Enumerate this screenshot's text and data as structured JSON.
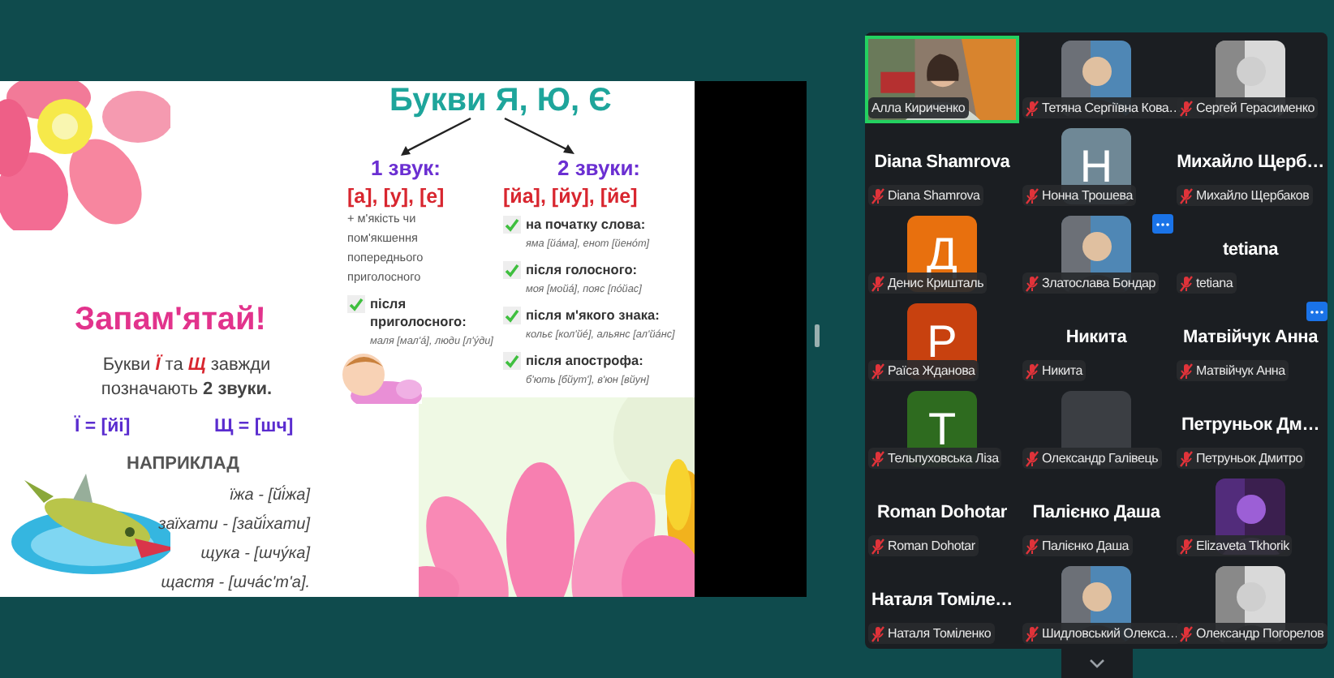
{
  "slide": {
    "title": "Букви Я, Ю, Є",
    "one_sound": {
      "heading": "1 звук:",
      "sounds": "[а], [у], [е]",
      "note": "+ м'якість чи пом'якшення попереднього приголосного",
      "rules": [
        {
          "label": "після приголосного:",
          "examples": "маля [мал'á], люди [л'у́ди]"
        }
      ]
    },
    "two_sounds": {
      "heading": "2 звуки:",
      "sounds": "[йа], [йу], [йе]",
      "rules": [
        {
          "label": "на початку слова:",
          "examples": "яма [йáма], енот [йенóт]"
        },
        {
          "label": "після голосного:",
          "examples": "моя [мойá], пояс [пóйас]"
        },
        {
          "label": "після м'якого знака:",
          "examples": "кольє [кол'йé], альянс [ал'йáнс]"
        },
        {
          "label": "після апострофа:",
          "examples": "б'ють [бйут'], в'юн [вйун]"
        }
      ]
    },
    "reminder": {
      "title": "Запам'ятай!",
      "text_parts": [
        {
          "text": "Букви ",
          "kind": "plain"
        },
        {
          "text": "Ї",
          "kind": "letter"
        },
        {
          "text": " та ",
          "kind": "plain"
        },
        {
          "text": "Щ",
          "kind": "letter"
        },
        {
          "text": " завжди позначають ",
          "kind": "plain"
        },
        {
          "text": "2 звуки.",
          "kind": "bold"
        }
      ],
      "formulas": [
        "Ї = [йі]",
        "Щ = [шч]"
      ],
      "examples_heading": "НАПРИКЛАД",
      "examples": [
        "їжа - [йі́жа]",
        "заїхати - [зайі́хати]",
        "щука - [шчу́ка]",
        "щастя - [шча́с'т'а]."
      ]
    }
  },
  "gallery": {
    "tiles": [
      {
        "kind": "video",
        "label": "Алла Кириченко",
        "muted": false,
        "speaking": true,
        "menu": false
      },
      {
        "label": "Тетяна Сергіївна Кова…",
        "muted": true,
        "speaking": false,
        "menu": false
      },
      {
        "label": "Сергей Герасименко",
        "muted": true,
        "speaking": false,
        "menu": false
      },
      {
        "kind": "name",
        "name": "Diana Shamrova",
        "label": "Diana Shamrova",
        "muted": true,
        "speaking": false,
        "menu": false
      },
      {
        "kind": "letter",
        "letter": "Н",
        "color": "#6f8896",
        "label": "Нонна Трошева",
        "muted": true,
        "speaking": false,
        "menu": false
      },
      {
        "kind": "name",
        "name": "Михайло  Щерб…",
        "label": "Михайло Щербаков",
        "muted": true,
        "speaking": false,
        "menu": false
      },
      {
        "kind": "letter",
        "letter": "Д",
        "color": "#e8700e",
        "label": "Денис Кришталь",
        "muted": true,
        "speaking": false,
        "menu": false
      },
      {
        "label": "Златослава Бондар",
        "muted": true,
        "speaking": false,
        "menu": true
      },
      {
        "kind": "name",
        "name": "tetiana",
        "label": "tetiana",
        "muted": true,
        "speaking": false,
        "menu": false
      },
      {
        "kind": "letter",
        "letter": "Р",
        "color": "#c8410f",
        "label": "Раїса Жданова",
        "muted": true,
        "speaking": false,
        "menu": false
      },
      {
        "kind": "name",
        "name": "Никита",
        "label": "Никита",
        "muted": true,
        "speaking": false,
        "menu": false
      },
      {
        "kind": "name",
        "name": "Матвійчук Анна",
        "label": "Матвійчук Анна",
        "muted": true,
        "speaking": false,
        "menu": true
      },
      {
        "kind": "letter",
        "letter": "Т",
        "color": "#2e6b1f",
        "label": "Тельпуховська Ліза",
        "muted": true,
        "speaking": false,
        "menu": false
      },
      {
        "kind": "blank",
        "label": "Олександр Галівець",
        "muted": true,
        "speaking": false,
        "menu": false
      },
      {
        "kind": "name",
        "name": "Петруньок Дм…",
        "label": "Петруньок Дмитро",
        "muted": true,
        "speaking": false,
        "menu": false
      },
      {
        "kind": "name",
        "name": "Roman Dohotar",
        "label": "Roman Dohotar",
        "muted": true,
        "speaking": false,
        "menu": false
      },
      {
        "kind": "name",
        "name": "Палієнко Даша",
        "label": "Палієнко Даша",
        "muted": true,
        "speaking": false,
        "menu": false
      },
      {
        "label": "Elizaveta Tkhorik",
        "muted": true,
        "speaking": false,
        "menu": false
      },
      {
        "kind": "name",
        "name": "Наталя  Томіле…",
        "label": "Наталя Томіленко",
        "muted": true,
        "speaking": false,
        "menu": false
      },
      {
        "label": "Шидловський Олекса…",
        "muted": true,
        "speaking": false,
        "menu": false
      },
      {
        "label": "Олександр Погорелов",
        "muted": true,
        "speaking": false,
        "menu": false
      }
    ]
  }
}
